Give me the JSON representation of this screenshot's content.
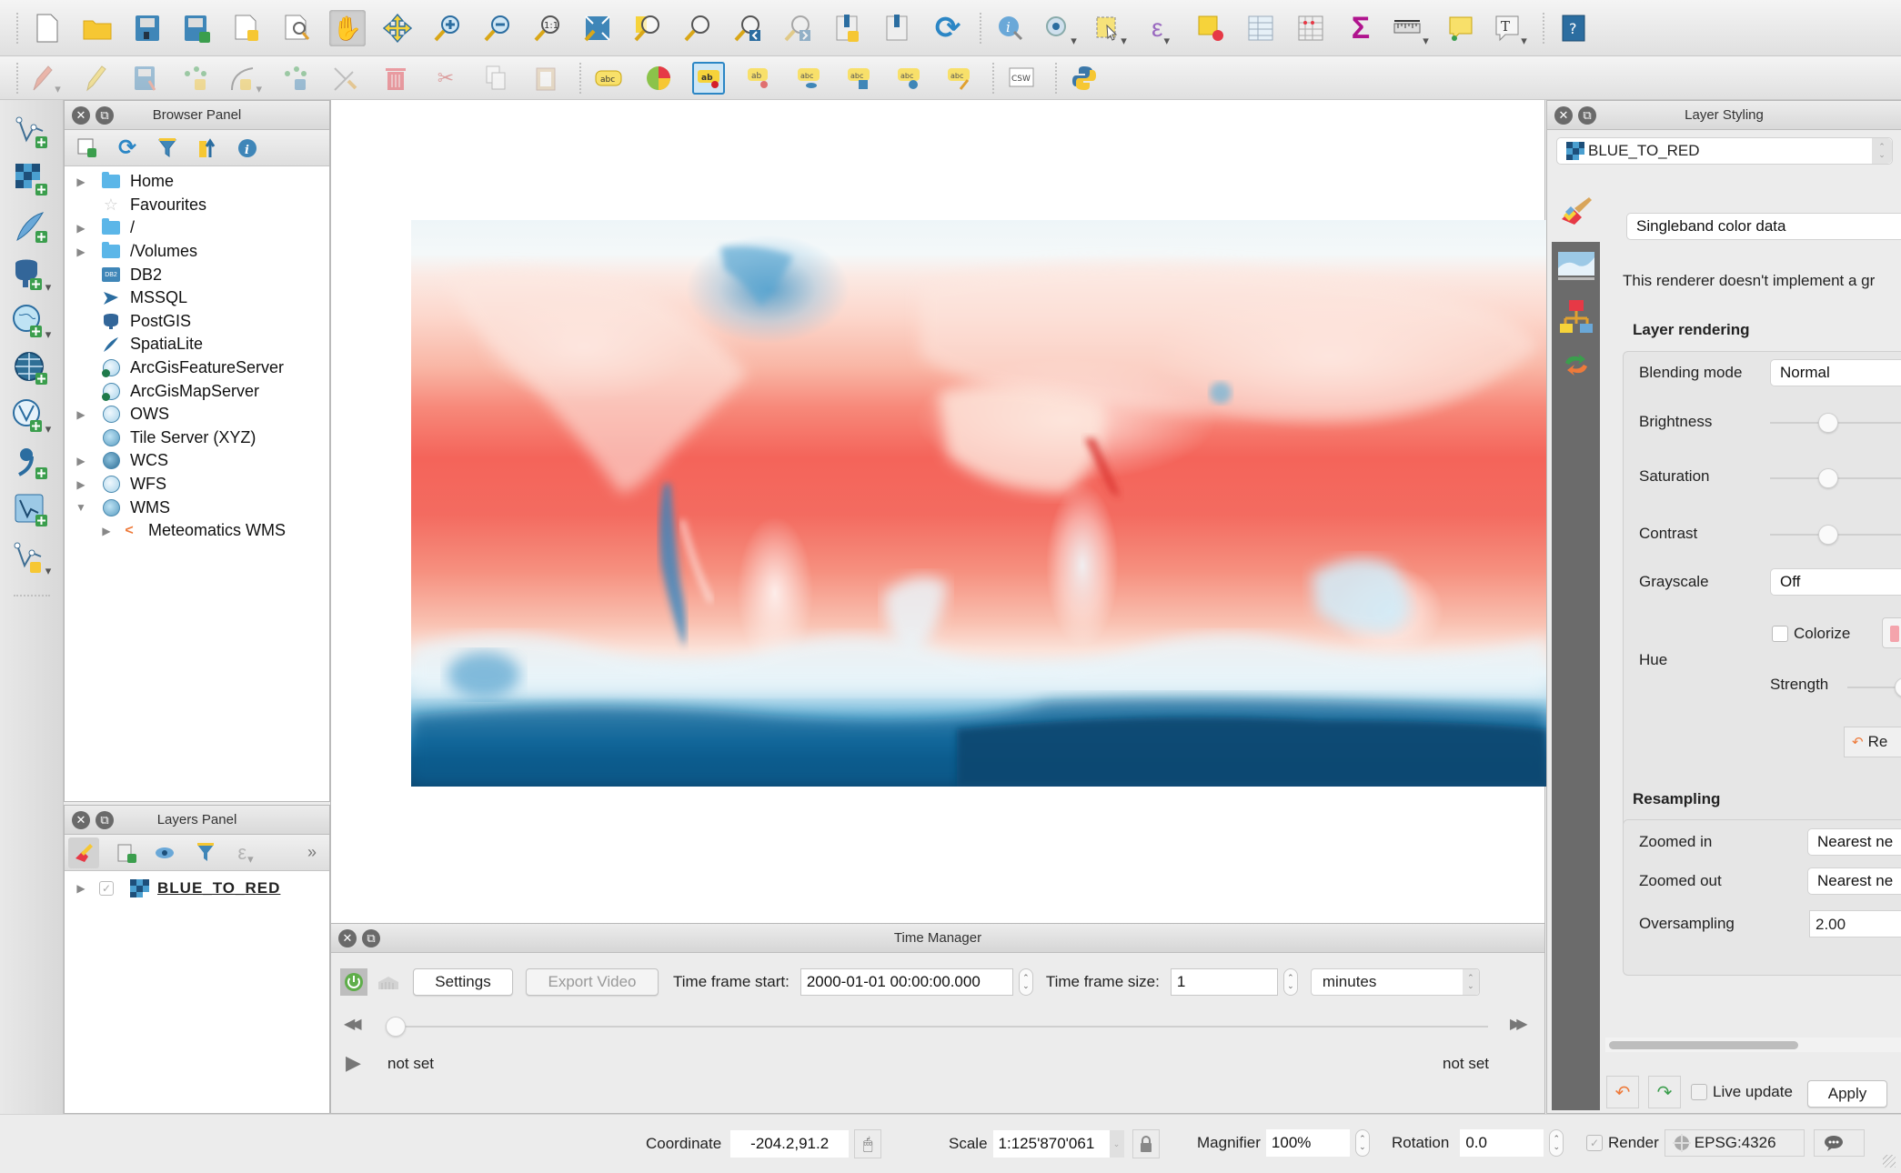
{
  "toolbar_main": {
    "buttons": [
      {
        "name": "new-project",
        "glyph": "🗋"
      },
      {
        "name": "open-project",
        "glyph": "📂"
      },
      {
        "name": "save-project",
        "glyph": "💾"
      },
      {
        "name": "save-project-as",
        "glyph": "💾"
      },
      {
        "name": "new-print-layout",
        "glyph": "🗋"
      },
      {
        "name": "layout-manager",
        "glyph": "🔍"
      },
      {
        "name": "pan-map",
        "glyph": "✋"
      },
      {
        "name": "pan-to-selection",
        "glyph": "✥"
      },
      {
        "name": "zoom-in",
        "glyph": "⊕"
      },
      {
        "name": "zoom-out",
        "glyph": "⊖"
      },
      {
        "name": "zoom-native",
        "glyph": "①"
      },
      {
        "name": "zoom-full",
        "glyph": "⛶"
      },
      {
        "name": "zoom-to-selection",
        "glyph": "🔍"
      },
      {
        "name": "zoom-to-layer",
        "glyph": "🔍"
      },
      {
        "name": "zoom-last",
        "glyph": "🔎"
      },
      {
        "name": "zoom-next",
        "glyph": "🔎"
      },
      {
        "name": "new-bookmark",
        "glyph": "🔖"
      },
      {
        "name": "show-bookmarks",
        "glyph": "🔖"
      },
      {
        "name": "refresh",
        "glyph": "⟳"
      },
      {
        "name": "identify-features",
        "glyph": "ⓘ"
      },
      {
        "name": "run-feature-action",
        "glyph": "⚙"
      },
      {
        "name": "select-features",
        "glyph": "⬚"
      },
      {
        "name": "select-by-expression",
        "glyph": "ε"
      },
      {
        "name": "deselect-all",
        "glyph": "▣"
      },
      {
        "name": "attribute-table",
        "glyph": "▦"
      },
      {
        "name": "field-calculator",
        "glyph": "▤"
      },
      {
        "name": "statistical-summary",
        "glyph": "Σ"
      },
      {
        "name": "measure",
        "glyph": "📏"
      },
      {
        "name": "map-tips",
        "glyph": "💬"
      },
      {
        "name": "text-annotation",
        "glyph": "T"
      },
      {
        "name": "help",
        "glyph": "?"
      }
    ]
  },
  "toolbar_digitizing": {
    "buttons": [
      {
        "name": "current-edits",
        "glyph": "✎"
      },
      {
        "name": "toggle-editing",
        "glyph": "✏"
      },
      {
        "name": "save-layer-edits",
        "glyph": "💾"
      },
      {
        "name": "add-feature",
        "glyph": "⁘"
      },
      {
        "name": "add-line-feature",
        "glyph": "⌒"
      },
      {
        "name": "move-feature",
        "glyph": "⁘"
      },
      {
        "name": "node-tool",
        "glyph": "⚒"
      },
      {
        "name": "delete-selected",
        "glyph": "🗑"
      },
      {
        "name": "cut-features",
        "glyph": "✂"
      },
      {
        "name": "copy-features",
        "glyph": "⎘"
      },
      {
        "name": "paste-features",
        "glyph": "📋"
      },
      {
        "name": "label-layer",
        "glyph": "abc"
      },
      {
        "name": "diagram-options",
        "glyph": "◕"
      },
      {
        "name": "pin-labels",
        "glyph": "ab"
      },
      {
        "name": "highlight-pinned-labels",
        "glyph": "ab"
      },
      {
        "name": "show-hide-labels",
        "glyph": "abc"
      },
      {
        "name": "move-label",
        "glyph": "abc"
      },
      {
        "name": "rotate-label",
        "glyph": "abc"
      },
      {
        "name": "change-label",
        "glyph": "abc"
      },
      {
        "name": "csw-client",
        "glyph": "CSW"
      },
      {
        "name": "python-console",
        "glyph": "🐍"
      }
    ]
  },
  "left_toolbar": {
    "buttons": [
      {
        "name": "add-vector-layer",
        "glyph": "V"
      },
      {
        "name": "add-raster-layer",
        "glyph": "▦"
      },
      {
        "name": "add-spatialite-layer",
        "glyph": "✒"
      },
      {
        "name": "add-postgis-layer",
        "glyph": "🐘"
      },
      {
        "name": "add-wms-layer",
        "glyph": "🌐"
      },
      {
        "name": "add-wcs-layer",
        "glyph": "🌐"
      },
      {
        "name": "add-wfs-layer",
        "glyph": "🌐"
      },
      {
        "name": "add-delimited-text-layer",
        "glyph": "❟"
      },
      {
        "name": "add-virtual-layer",
        "glyph": "V"
      },
      {
        "name": "new-shapefile-layer",
        "glyph": "V"
      }
    ]
  },
  "browser_panel": {
    "title": "Browser Panel",
    "tree": [
      {
        "label": "Home",
        "icon": "folder",
        "expander": "collapsed",
        "indent": 0
      },
      {
        "label": "Favourites",
        "icon": "star",
        "expander": "none",
        "indent": 0
      },
      {
        "label": "/",
        "icon": "folder",
        "expander": "collapsed",
        "indent": 0
      },
      {
        "label": "/Volumes",
        "icon": "folder",
        "expander": "collapsed",
        "indent": 0
      },
      {
        "label": "DB2",
        "icon": "db2",
        "expander": "none",
        "indent": 0
      },
      {
        "label": "MSSQL",
        "icon": "mssql",
        "expander": "none",
        "indent": 0
      },
      {
        "label": "PostGIS",
        "icon": "postgis",
        "expander": "none",
        "indent": 0
      },
      {
        "label": "SpatiaLite",
        "icon": "spatialite",
        "expander": "none",
        "indent": 0
      },
      {
        "label": "ArcGisFeatureServer",
        "icon": "arcgis",
        "expander": "none",
        "indent": 0
      },
      {
        "label": "ArcGisMapServer",
        "icon": "arcgis",
        "expander": "none",
        "indent": 0
      },
      {
        "label": "OWS",
        "icon": "globe-light",
        "expander": "collapsed",
        "indent": 0
      },
      {
        "label": "Tile Server (XYZ)",
        "icon": "globe",
        "expander": "none",
        "indent": 0
      },
      {
        "label": "WCS",
        "icon": "globe-dark",
        "expander": "collapsed",
        "indent": 0
      },
      {
        "label": "WFS",
        "icon": "globe-light",
        "expander": "collapsed",
        "indent": 0
      },
      {
        "label": "WMS",
        "icon": "globe",
        "expander": "expanded",
        "indent": 0
      },
      {
        "label": "Meteomatics WMS",
        "icon": "wms-connection",
        "expander": "collapsed",
        "indent": 1
      }
    ]
  },
  "layers_panel": {
    "title": "Layers Panel",
    "layers": [
      {
        "name": "BLUE_TO_RED",
        "visible": true
      }
    ]
  },
  "map": {
    "layer": "BLUE_TO_RED",
    "colormap": [
      "#08466f",
      "#1f7fb4",
      "#bfe0ef",
      "#f4f8f9",
      "#fcd7cc",
      "#f7897a",
      "#f4645a"
    ]
  },
  "time_manager": {
    "title": "Time Manager",
    "settings_label": "Settings",
    "export_video_label": "Export Video",
    "time_frame_start_label": "Time frame start:",
    "time_frame_start_value": "2000-01-01 00:00:00.000",
    "time_frame_size_label": "Time frame size:",
    "time_frame_size_value": "1",
    "time_unit": "minutes",
    "slider_position": 0,
    "start_status": "not set",
    "end_status": "not set"
  },
  "layer_styling": {
    "title": "Layer Styling",
    "selected_layer": "BLUE_TO_RED",
    "renderer_type": "Singleband color data",
    "renderer_message": "This renderer doesn't implement a gr",
    "layer_rendering": {
      "heading": "Layer rendering",
      "blending_mode_label": "Blending mode",
      "blending_mode_value": "Normal",
      "brightness_label": "Brightness",
      "brightness_fraction": 0.5,
      "saturation_label": "Saturation",
      "saturation_fraction": 0.5,
      "contrast_label": "Contrast",
      "contrast_fraction": 0.5,
      "grayscale_label": "Grayscale",
      "grayscale_value": "Off",
      "hue_label": "Hue",
      "colorize_label": "Colorize",
      "colorize_checked": false,
      "strength_label": "Strength",
      "reset_label": "Re"
    },
    "resampling": {
      "heading": "Resampling",
      "zoomed_in_label": "Zoomed in",
      "zoomed_in_value": "Nearest ne",
      "zoomed_out_label": "Zoomed out",
      "zoomed_out_value": "Nearest ne",
      "oversampling_label": "Oversampling",
      "oversampling_value": "2.00"
    },
    "live_update_label": "Live update",
    "live_update_checked": false,
    "apply_label": "Apply"
  },
  "statusbar": {
    "coordinate_label": "Coordinate",
    "coordinate_value": "-204.2,91.2",
    "scale_label": "Scale",
    "scale_value": "1:125'870'061",
    "magnifier_label": "Magnifier",
    "magnifier_value": "100%",
    "rotation_label": "Rotation",
    "rotation_value": "0.0",
    "render_label": "Render",
    "render_checked": true,
    "crs_label": "EPSG:4326"
  }
}
